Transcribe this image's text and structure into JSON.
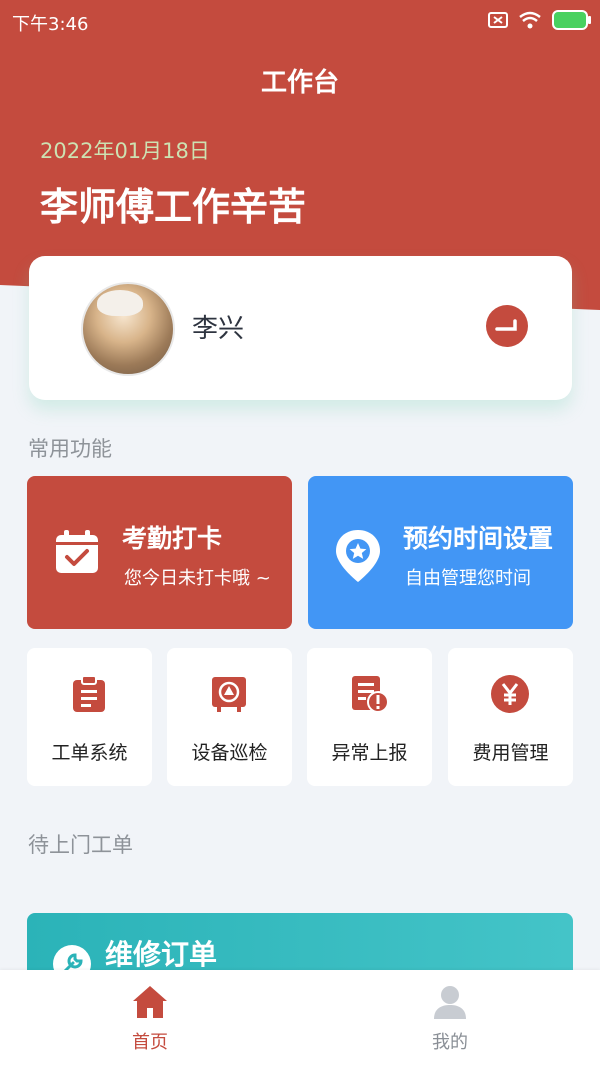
{
  "status_bar": {
    "time": "下午3:46"
  },
  "header": {
    "title": "工作台",
    "date": "2022年01月18日",
    "greeting": "李师傅工作辛苦"
  },
  "user": {
    "name": "李兴"
  },
  "sections": {
    "common": "常用功能",
    "pending": "待上门工单"
  },
  "feature_cards": [
    {
      "title": "考勤打卡",
      "subtitle": "您今日未打卡哦 ~"
    },
    {
      "title": "预约时间设置",
      "subtitle": "自由管理您时间"
    }
  ],
  "tiles": [
    {
      "label": "工单系统",
      "icon": "clipboard-icon"
    },
    {
      "label": "设备巡检",
      "icon": "inspection-icon"
    },
    {
      "label": "异常上报",
      "icon": "report-icon"
    },
    {
      "label": "费用管理",
      "icon": "yen-icon"
    }
  ],
  "orders": {
    "repair_title": "维修订单"
  },
  "tabbar": [
    {
      "label": "首页",
      "icon": "home-icon",
      "active": true
    },
    {
      "label": "我的",
      "icon": "profile-icon",
      "active": false
    }
  ],
  "colors": {
    "primary": "#c44b3e",
    "blue": "#4296f5",
    "teal": "#2bb3b8",
    "date_text": "#cde2b2",
    "background": "#f1f4f8"
  }
}
